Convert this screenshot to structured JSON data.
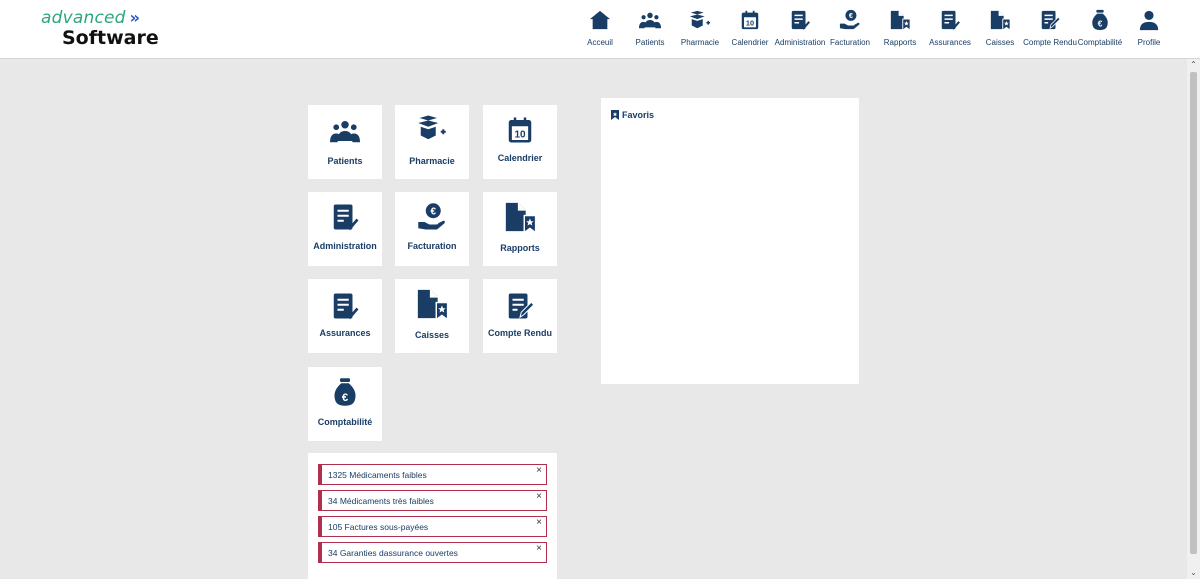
{
  "brand": {
    "line1": "advanced",
    "line2": "Software",
    "chevron": "»"
  },
  "nav": {
    "items": [
      {
        "label": "Acceuil",
        "icon": "home-icon"
      },
      {
        "label": "Patients",
        "icon": "users-icon"
      },
      {
        "label": "Pharmacie",
        "icon": "boxes-icon"
      },
      {
        "label": "Calendrier",
        "icon": "calendar-icon"
      },
      {
        "label": "Administration",
        "icon": "document-check-icon"
      },
      {
        "label": "Facturation",
        "icon": "hand-euro-icon"
      },
      {
        "label": "Rapports",
        "icon": "file-bookmark-icon"
      },
      {
        "label": "Assurances",
        "icon": "document-check-icon"
      },
      {
        "label": "Caisses",
        "icon": "file-bookmark-icon"
      },
      {
        "label": "Compte Rendu",
        "icon": "document-edit-icon"
      },
      {
        "label": "Comptabilité",
        "icon": "money-bag-icon"
      },
      {
        "label": "Profile",
        "icon": "user-icon"
      }
    ]
  },
  "tiles": [
    {
      "label": "Patients",
      "icon": "users-icon"
    },
    {
      "label": "Pharmacie",
      "icon": "boxes-icon"
    },
    {
      "label": "Calendrier",
      "icon": "calendar-icon",
      "day": "10"
    },
    {
      "label": "Administration",
      "icon": "document-check-icon"
    },
    {
      "label": "Facturation",
      "icon": "hand-euro-icon"
    },
    {
      "label": "Rapports",
      "icon": "file-bookmark-icon"
    },
    {
      "label": "Assurances",
      "icon": "document-check-icon"
    },
    {
      "label": "Caisses",
      "icon": "file-bookmark-icon"
    },
    {
      "label": "Compte Rendu",
      "icon": "document-edit-icon"
    },
    {
      "label": "Comptabilité",
      "icon": "money-bag-icon"
    }
  ],
  "favoris": {
    "title": "Favoris"
  },
  "alerts": [
    {
      "text": "1325 Médicaments faibles",
      "close": "×"
    },
    {
      "text": "34 Médicaments très faibles",
      "close": "×"
    },
    {
      "text": "105 Factures sous-payées",
      "close": "×"
    },
    {
      "text": "34 Garanties dassurance ouvertes",
      "close": "×"
    }
  ],
  "colors": {
    "primary": "#1a3d66",
    "brand_green": "#2aa87a",
    "brand_blue": "#1f56c7",
    "alert_border": "#b0304d",
    "background": "#e8e8e8"
  }
}
